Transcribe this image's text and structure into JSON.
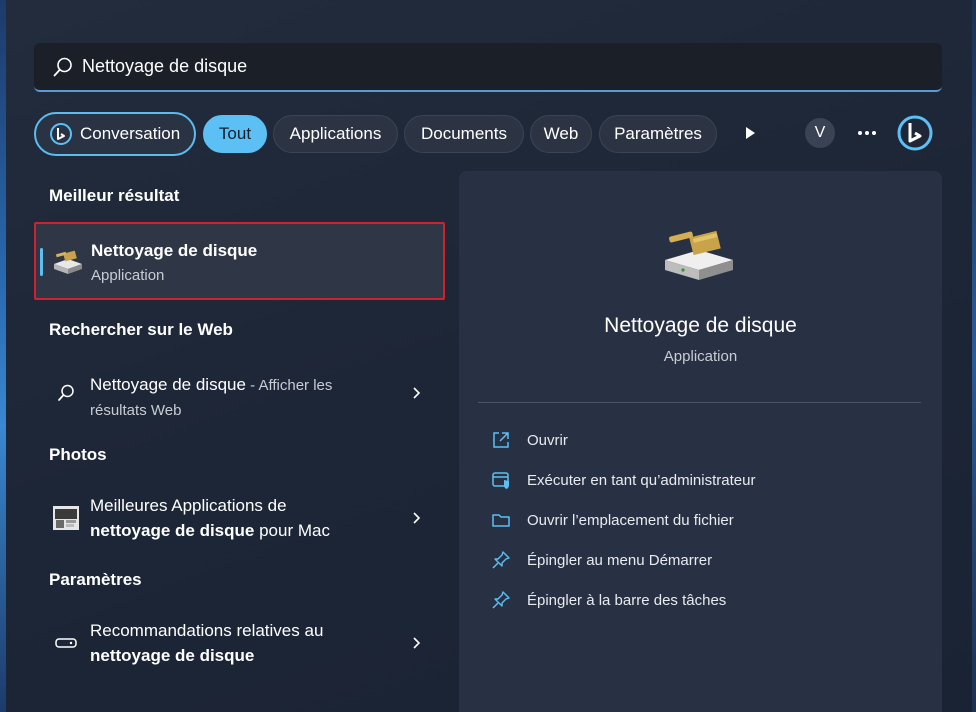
{
  "search": {
    "value": "Nettoyage de disque",
    "icon": "search-icon"
  },
  "filters": {
    "conversation": "Conversation",
    "tabs": [
      "Tout",
      "Applications",
      "Documents",
      "Web",
      "Paramètres"
    ],
    "active": "Tout",
    "avatar_letter": "V",
    "accent_color": "#5cc0f4"
  },
  "left": {
    "best_heading": "Meilleur résultat",
    "best": {
      "title": "Nettoyage de disque",
      "subtitle": "Application"
    },
    "web_heading": "Rechercher sur le Web",
    "web": {
      "title": "Nettoyage de disque",
      "suffix": " - Afficher les",
      "line2": "résultats Web"
    },
    "photos_heading": "Photos",
    "photos": {
      "line1": "Meilleures Applications de",
      "line2_bold": "nettoyage de disque",
      "line2_rest": " pour Mac"
    },
    "settings_heading": "Paramètres",
    "settings": {
      "line1": "Recommandations relatives au",
      "line2_bold": "nettoyage de disque"
    }
  },
  "right": {
    "title": "Nettoyage de disque",
    "subtitle": "Application",
    "actions": [
      {
        "label": "Ouvrir",
        "icon": "open-external-icon"
      },
      {
        "label": "Exécuter en tant qu’administrateur",
        "icon": "shield-admin-icon"
      },
      {
        "label": "Ouvrir l’emplacement du fichier",
        "icon": "folder-icon"
      },
      {
        "label": "Épingler au menu Démarrer",
        "icon": "pin-icon"
      },
      {
        "label": "Épingler à la barre des tâches",
        "icon": "pin-icon"
      }
    ]
  }
}
